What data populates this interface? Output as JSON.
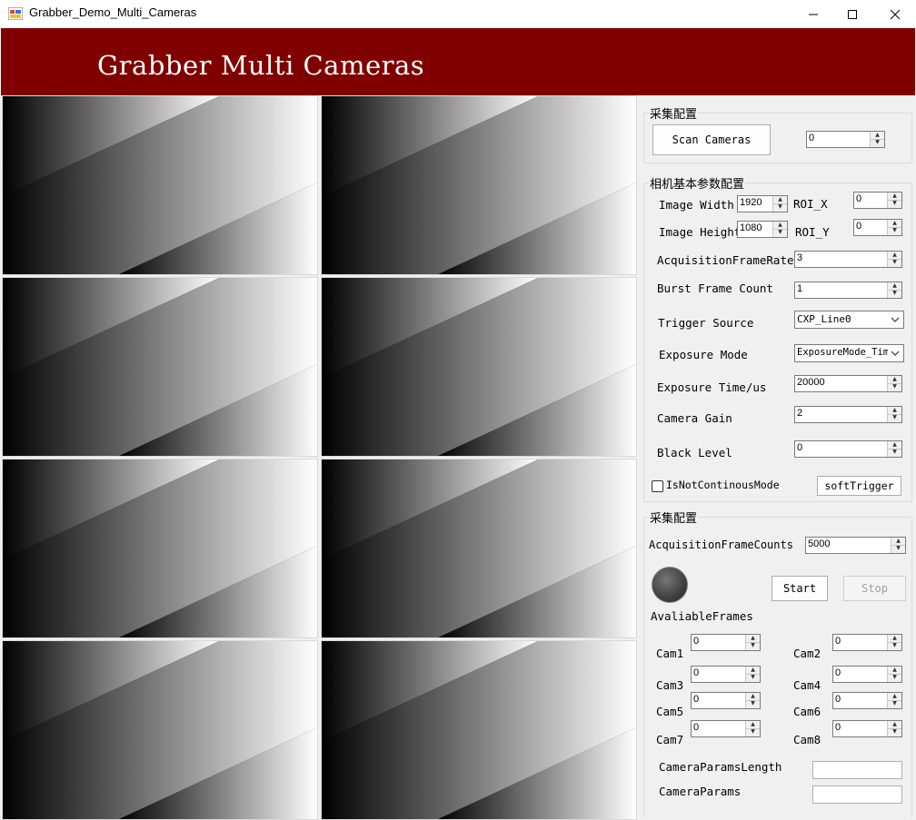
{
  "window": {
    "title": "Grabber_Demo_Multi_Cameras"
  },
  "banner": {
    "title": "Grabber Multi Cameras"
  },
  "cameras": [
    "cam1",
    "cam2",
    "cam3",
    "cam4",
    "cam5",
    "cam6",
    "cam7",
    "cam8"
  ],
  "scan_group": {
    "title": "采集配置",
    "scan_button": "Scan Cameras",
    "camera_count": "0"
  },
  "params_group": {
    "title": "相机基本参数配置",
    "image_width_label": "Image Width",
    "image_width": "1920",
    "roi_x_label": "ROI_X",
    "roi_x": "0",
    "image_height_label": "Image Height",
    "image_height": "1080",
    "roi_y_label": "ROI_Y",
    "roi_y": "0",
    "frame_rate_label": "AcquisitionFrameRate",
    "frame_rate": "3",
    "burst_label": "Burst Frame Count",
    "burst": "1",
    "trigger_source_label": "Trigger Source",
    "trigger_source": "CXP_Line0",
    "exposure_mode_label": "Exposure Mode",
    "exposure_mode": "ExposureMode_Timed",
    "exposure_time_label": "Exposure Time/us",
    "exposure_time": "20000",
    "gain_label": "Camera Gain",
    "gain": "2",
    "black_level_label": "Black Level",
    "black_level": "0",
    "not_continuous_label": "IsNotContinousMode",
    "soft_trigger_button": "softTrigger"
  },
  "acq_group": {
    "title": "采集配置",
    "frame_counts_label": "AcquisitionFrameCounts",
    "frame_counts": "5000",
    "start_button": "Start",
    "stop_button": "Stop",
    "available_frames_label": "AvaliableFrames",
    "cams": [
      {
        "label": "Cam1",
        "value": "0"
      },
      {
        "label": "Cam2",
        "value": "0"
      },
      {
        "label": "Cam3",
        "value": "0"
      },
      {
        "label": "Cam4",
        "value": "0"
      },
      {
        "label": "Cam5",
        "value": "0"
      },
      {
        "label": "Cam6",
        "value": "0"
      },
      {
        "label": "Cam7",
        "value": "0"
      },
      {
        "label": "Cam8",
        "value": "0"
      }
    ],
    "params_length_label": "CameraParamsLength",
    "params_length": "",
    "params_label": "CameraParams",
    "params": ""
  },
  "colors": {
    "banner": "#800000",
    "status_indicator": "#444444"
  }
}
